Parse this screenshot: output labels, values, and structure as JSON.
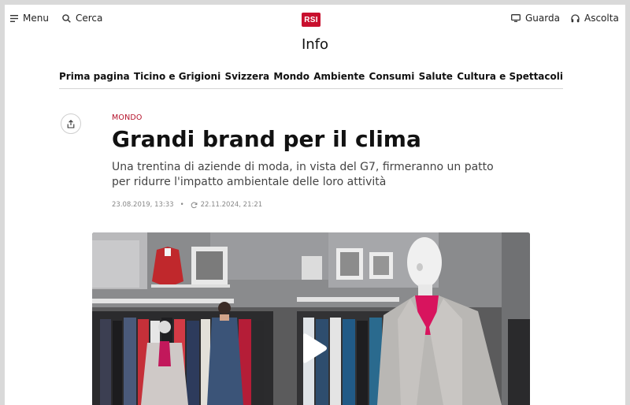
{
  "topbar": {
    "menu_label": "Menu",
    "search_label": "Cerca",
    "logo_text": "RSI",
    "watch_label": "Guarda",
    "listen_label": "Ascolta",
    "accent": "#c8102e"
  },
  "section": {
    "title": "Info"
  },
  "nav": {
    "items": [
      "Prima pagina",
      "Ticino e Grigioni",
      "Svizzera",
      "Mondo",
      "Ambiente",
      "Consumi",
      "Salute",
      "Cultura e Spettacoli"
    ]
  },
  "article": {
    "category": "MONDO",
    "headline": "Grandi brand per il clima",
    "subtitle": "Una trentina di aziende di moda, in vista del G7, firmeranno un patto per ridurre l'impatto ambientale delle loro attività",
    "published": "23.08.2019, 13:33",
    "separator": "•",
    "updated": "22.11.2024, 21:21"
  },
  "media": {
    "play_icon": "play-icon"
  }
}
